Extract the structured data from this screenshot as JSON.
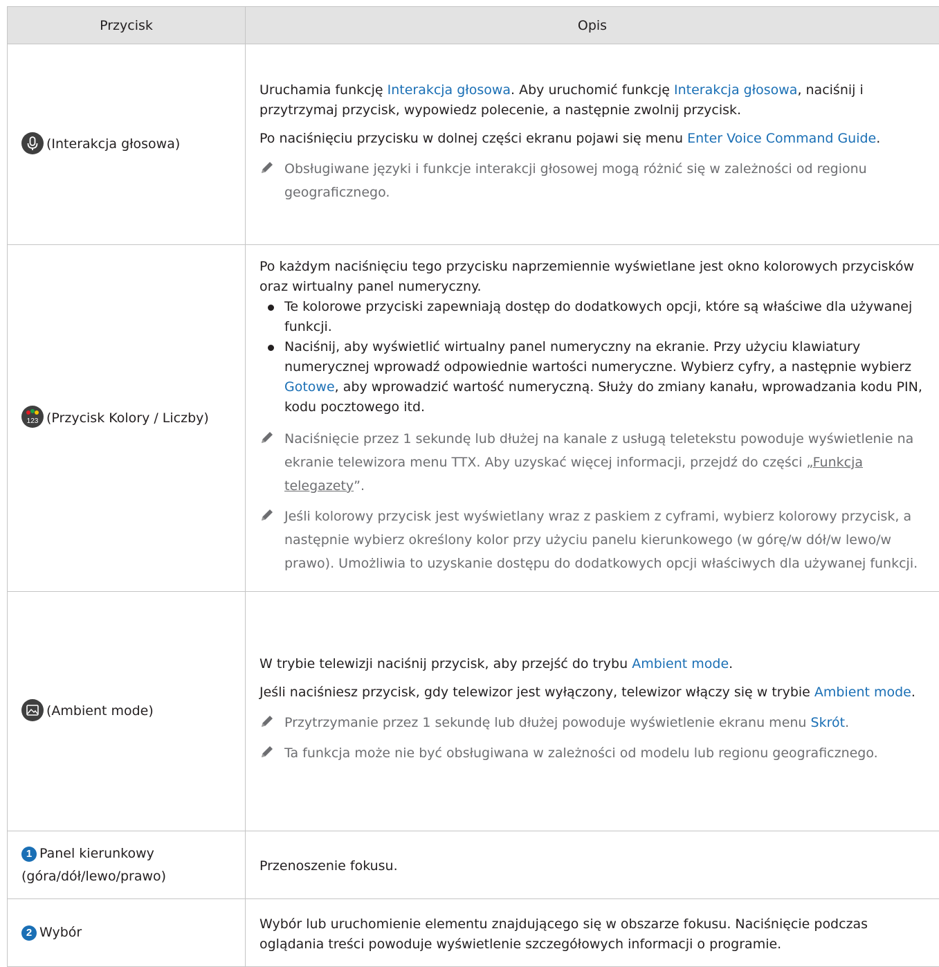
{
  "header": {
    "col1": "Przycisk",
    "col2": "Opis"
  },
  "rows": [
    {
      "button": "(Interakcja głosowa)",
      "icon": "microphone-icon",
      "p1_a": "Uruchamia funkcję ",
      "p1_link1": "Interakcja głosowa",
      "p1_b": ". Aby uruchomić funkcję ",
      "p1_link2": "Interakcja głosowa",
      "p1_c": ", naciśnij i przytrzymaj przycisk, wypowiedz polecenie, a następnie zwolnij przycisk.",
      "p2_a": "Po naciśnięciu przycisku w dolnej części ekranu pojawi się menu ",
      "p2_link": "Enter Voice Command Guide",
      "p2_b": ".",
      "note1": "Obsługiwane języki i funkcje interakcji głosowej mogą różnić się w zależności od regionu geograficznego."
    },
    {
      "button": "(Przycisk Kolory / Liczby)",
      "icon": "color-number-icon",
      "icon_text": "123",
      "p1": "Po każdym naciśnięciu tego przycisku naprzemiennie wyświetlane jest okno kolorowych przycisków oraz wirtualny panel numeryczny.",
      "bullet1": "Te kolorowe przyciski zapewniają dostęp do dodatkowych opcji, które są właściwe dla używanej funkcji.",
      "bullet2_a": "Naciśnij, aby wyświetlić wirtualny panel numeryczny na ekranie. Przy użyciu klawiatury numerycznej wprowadź odpowiednie wartości numeryczne. Wybierz cyfry, a następnie wybierz ",
      "bullet2_link": "Gotowe",
      "bullet2_b": ", aby wprowadzić wartość numeryczną. Służy do zmiany kanału, wprowadzania kodu PIN, kodu pocztowego itd.",
      "note1_a": "Naciśnięcie przez 1 sekundę lub dłużej na kanale z usługą teletekstu powoduje wyświetlenie na ekranie telewizora menu TTX. Aby uzyskać więcej informacji, przejdź do części „",
      "note1_link": "Funkcja telegazety",
      "note1_b": "”.",
      "note2": "Jeśli kolorowy przycisk jest wyświetlany wraz z paskiem z cyframi, wybierz kolorowy przycisk, a następnie wybierz określony kolor przy użyciu panelu kierunkowego (w górę/w dół/w lewo/w prawo). Umożliwia to uzyskanie dostępu do dodatkowych opcji właściwych dla używanej funkcji."
    },
    {
      "button": "(Ambient mode)",
      "icon": "ambient-mode-icon",
      "p1_a": "W trybie telewizji naciśnij przycisk, aby przejść do trybu ",
      "p1_link": "Ambient mode",
      "p1_b": ".",
      "p2_a": "Jeśli naciśniesz przycisk, gdy telewizor jest wyłączony, telewizor włączy się w trybie ",
      "p2_link": "Ambient mode",
      "p2_b": ".",
      "note1_a": "Przytrzymanie przez 1 sekundę lub dłużej powoduje wyświetlenie ekranu menu ",
      "note1_link": "Skrót",
      "note1_b": ".",
      "note2": "Ta funkcja może nie być obsługiwana w zależności od modelu lub regionu geograficznego."
    },
    {
      "num": "1",
      "button": "Panel kierunkowy (góra/dół/lewo/prawo)",
      "desc": "Przenoszenie fokusu."
    },
    {
      "num": "2",
      "button": "Wybór",
      "desc": "Wybór lub uruchomienie elementu znajdującego się w obszarze fokusu. Naciśnięcie podczas oglądania treści powoduje wyświetlenie szczegółowych informacji o programie."
    }
  ],
  "colors": {
    "link": "#1a6fb5",
    "note": "#6d6e71",
    "header_bg": "#e3e3e3",
    "border": "#c5c5c5"
  }
}
